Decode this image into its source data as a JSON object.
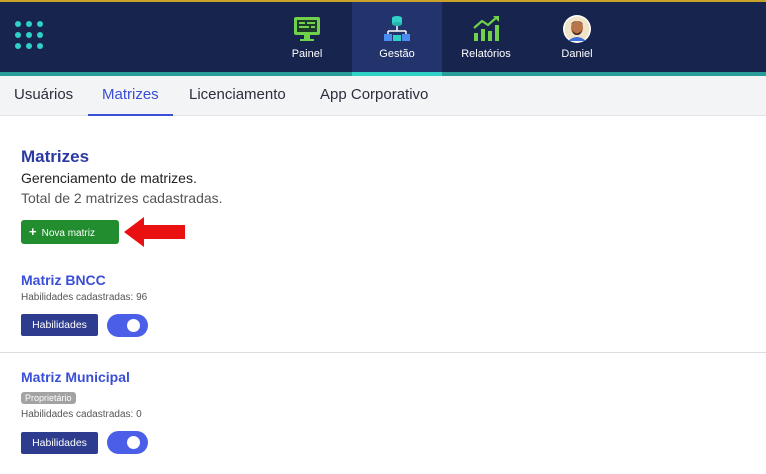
{
  "header": {
    "nav": [
      {
        "label": "Painel",
        "icon": "monitor-icon",
        "active": false
      },
      {
        "label": "Gestão",
        "icon": "hierarchy-icon",
        "active": true
      },
      {
        "label": "Relatórios",
        "icon": "chart-growth-icon",
        "active": false
      },
      {
        "label": "Daniel",
        "icon": "avatar",
        "active": false
      }
    ],
    "accent": "#2fd1c7",
    "background": "#17244e"
  },
  "subnav": {
    "tabs": [
      {
        "label": "Usuários",
        "active": false
      },
      {
        "label": "Matrizes",
        "active": true
      },
      {
        "label": "Licenciamento",
        "active": false
      },
      {
        "label": "App Corporativo",
        "active": false
      }
    ]
  },
  "main": {
    "title": "Matrizes",
    "subtitle": "Gerenciamento de matrizes.",
    "total": "Total de 2 matrizes cadastradas.",
    "new_button": "Nova matriz",
    "matrices": [
      {
        "name": "Matriz BNCC",
        "badge": "",
        "count": "Habilidades cadastradas: 96",
        "button": "Habilidades",
        "enabled": true
      },
      {
        "name": "Matriz Municipal",
        "badge": "Proprietário",
        "count": "Habilidades cadastradas: 0",
        "button": "Habilidades",
        "enabled": true
      }
    ]
  }
}
